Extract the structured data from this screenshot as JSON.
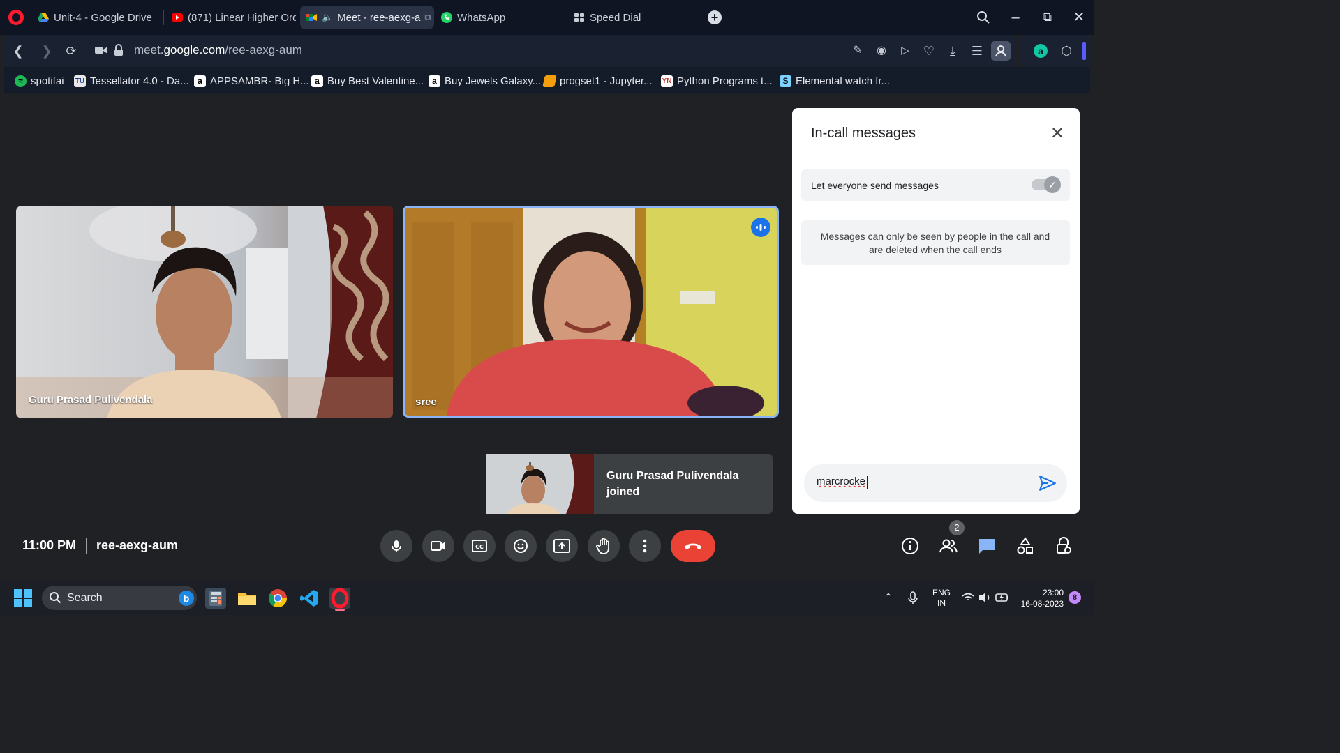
{
  "browser": {
    "tabs": [
      {
        "label": "Unit-4 - Google Drive",
        "icon": "google-drive-icon"
      },
      {
        "label": "(871) Linear Higher Ord",
        "icon": "youtube-icon"
      },
      {
        "label": "Meet - ree-aexg-a",
        "icon": "google-meet-icon",
        "active": true
      },
      {
        "label": "WhatsApp",
        "icon": "whatsapp-icon"
      },
      {
        "label": "Speed Dial",
        "icon": "speed-dial-icon"
      }
    ],
    "new_tab": "+",
    "url": {
      "host_prefix": "meet.",
      "host": "google.com",
      "path": "/ree-aexg-aum"
    },
    "bookmarks": [
      {
        "label": "spotifai",
        "icon": "spotify-icon"
      },
      {
        "label": "Tessellator 4.0 - Da...",
        "icon": "tessellator-icon"
      },
      {
        "label": "APPSAMBR- Big H...",
        "icon": "amazon-icon"
      },
      {
        "label": "Buy Best Valentine...",
        "icon": "amazon-icon"
      },
      {
        "label": "Buy Jewels Galaxy...",
        "icon": "amazon-icon"
      },
      {
        "label": "progset1 - Jupyter...",
        "icon": "jupyter-icon"
      },
      {
        "label": "Python Programs t...",
        "icon": "python-programs-icon"
      },
      {
        "label": "Elemental watch fr...",
        "icon": "elemental-icon"
      }
    ]
  },
  "meet": {
    "participants": [
      {
        "name": "Guru Prasad Pulivendala",
        "speaking": false
      },
      {
        "name": "sree",
        "speaking": true
      }
    ],
    "toast": {
      "text": "Guru Prasad Pulivendala joined"
    },
    "panel": {
      "title": "In-call messages",
      "permission_label": "Let everyone send messages",
      "permission_on": true,
      "info": "Messages can only be seen by people in the call and are deleted when the call ends",
      "input_value": "marcrocke"
    },
    "bottom_bar": {
      "time": "11:00 PM",
      "meeting_code": "ree-aexg-aum",
      "people_count": "2"
    },
    "colors": {
      "accent": "#1a73e8",
      "end_call": "#ea4335",
      "speaking_border": "#8ab4f8"
    }
  },
  "taskbar": {
    "search_label": "Search",
    "language": "ENG",
    "region": "IN",
    "time": "23:00",
    "date": "16-08-2023",
    "notification_count": "8"
  }
}
